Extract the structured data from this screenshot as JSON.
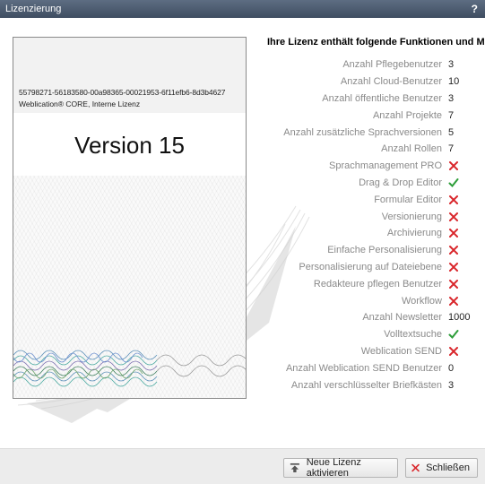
{
  "window": {
    "title": "Lizenzierung",
    "help_label": "?"
  },
  "license_card": {
    "license_key": "55798271-56183580-00a98365-00021953-6f11efb6-8d3b4627",
    "edition": "Weblication® CORE, Interne Lizenz",
    "version_label": "Version 15"
  },
  "features": {
    "heading": "Ihre Lizenz enthält folgende Funktionen und Module",
    "rows": [
      {
        "label": "Anzahl Pflegebenutzer",
        "value": "3"
      },
      {
        "label": "Anzahl Cloud-Benutzer",
        "value": "10"
      },
      {
        "label": "Anzahl öffentliche Benutzer",
        "value": "3"
      },
      {
        "label": "Anzahl Projekte",
        "value": "7"
      },
      {
        "label": "Anzahl zusätzliche Sprachversionen",
        "value": "5"
      },
      {
        "label": "Anzahl Rollen",
        "value": "7"
      },
      {
        "label": "Sprachmanagement PRO",
        "status": "no"
      },
      {
        "label": "Drag & Drop Editor",
        "status": "yes"
      },
      {
        "label": "Formular Editor",
        "status": "no"
      },
      {
        "label": "Versionierung",
        "status": "no"
      },
      {
        "label": "Archivierung",
        "status": "no"
      },
      {
        "label": "Einfache Personalisierung",
        "status": "no"
      },
      {
        "label": "Personalisierung auf Dateiebene",
        "status": "no"
      },
      {
        "label": "Redakteure pflegen Benutzer",
        "status": "no"
      },
      {
        "label": "Workflow",
        "status": "no"
      },
      {
        "label": "Anzahl Newsletter",
        "value": "1000"
      },
      {
        "label": "Volltextsuche",
        "status": "yes"
      },
      {
        "label": "Weblication SEND",
        "status": "no"
      },
      {
        "label": "Anzahl Weblication SEND Benutzer",
        "value": "0"
      },
      {
        "label": "Anzahl verschlüsselter Briefkästen",
        "value": "3"
      }
    ]
  },
  "footer": {
    "activate_label": "Neue Lizenz aktivieren",
    "close_label": "Schließen"
  },
  "colors": {
    "titlebar": "#4a586c",
    "check": "#2e9e3a",
    "cross": "#d9262b",
    "label_gray": "#8a8a8a"
  },
  "icons": {
    "yes": "check-icon",
    "no": "cross-icon",
    "activate": "upload-arrow-icon",
    "close": "close-icon"
  }
}
